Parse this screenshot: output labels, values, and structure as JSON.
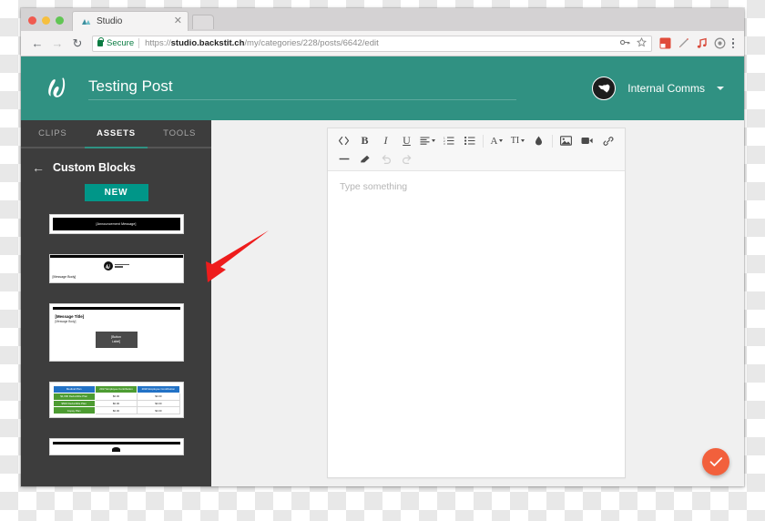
{
  "browser": {
    "tab": {
      "title": "Studio",
      "favicon_icon": "studio-favicon",
      "close_icon": "close-icon"
    },
    "new_tab_icon": "new-tab-icon",
    "nav": {
      "back_icon": "back-arrow-icon",
      "forward_icon": "forward-arrow-icon",
      "reload_icon": "reload-icon"
    },
    "omnibox": {
      "secure_label": "Secure",
      "url_scheme": "https://",
      "url_host": "studio.backstit.ch",
      "url_path": "/my/categories/228/posts/6642/edit",
      "full_url": "https://studio.backstit.ch/my/categories/228/posts/6642/edit",
      "key_icon": "key-icon",
      "star_icon": "star-icon"
    },
    "extensions": [
      "extension-red-icon",
      "extension-pencil-icon",
      "extension-music-icon",
      "extension-grey-icon"
    ],
    "menu_icon": "kebab-menu-icon",
    "traffic_lights": [
      "close-window-button",
      "minimize-window-button",
      "maximize-window-button"
    ]
  },
  "app": {
    "header": {
      "logo_icon": "backstitch-logo",
      "post_title": "Testing Post",
      "account": {
        "avatar_icon": "globe-avatar-icon",
        "name": "Internal Comms",
        "caret_icon": "chevron-down-icon"
      },
      "accent_color": "#309182"
    },
    "sidebar": {
      "tabs": [
        {
          "label": "CLIPS",
          "active": false
        },
        {
          "label": "ASSETS",
          "active": true
        },
        {
          "label": "TOOLS",
          "active": false
        }
      ],
      "back_icon": "back-arrow-icon",
      "section_title": "Custom Blocks",
      "new_button": "NEW",
      "new_button_color": "#009688",
      "blocks": [
        {
          "name": "announcement-block",
          "announcement_text": "[Announcement Message]"
        },
        {
          "name": "logo-message-block",
          "logo_text": "backstitch",
          "logo_sub": "STUDIO",
          "body_text": "[Message Body]"
        },
        {
          "name": "title-body-button-block",
          "title_text": "[Message Title]",
          "body_text": "[Message Body]",
          "button_line1": "[Button",
          "button_line2": "Label]"
        },
        {
          "name": "benefits-table-block",
          "table": {
            "headers": [
              "Medical Plan",
              "2017 Employee Contribution",
              "2018 Employee Contribution"
            ],
            "rows": [
              {
                "label": "$1,000 Deductible Plan",
                "values": [
                  "$0.00",
                  "$0.00"
                ]
              },
              {
                "label": "$500 Deductible Plan",
                "values": [
                  "$0.00",
                  "$0.00"
                ]
              },
              {
                "label": "Copay Plan",
                "values": [
                  "$0.00",
                  "$0.00"
                ]
              }
            ],
            "header_color": "#2272c6",
            "label_color": "#4d9c32"
          }
        },
        {
          "name": "partial-block",
          "label": ""
        }
      ]
    },
    "editor": {
      "toolbar_row1": [
        {
          "name": "code-view-button",
          "glyph": "< >"
        },
        {
          "name": "bold-button",
          "glyph": "B"
        },
        {
          "name": "italic-button",
          "glyph": "I"
        },
        {
          "name": "underline-button",
          "glyph": "U"
        },
        {
          "name": "align-button",
          "glyph": "align"
        },
        {
          "name": "ordered-list-button",
          "glyph": "ol"
        },
        {
          "name": "unordered-list-button",
          "glyph": "ul"
        },
        {
          "name": "text-color-button",
          "glyph": "A"
        },
        {
          "name": "font-size-button",
          "glyph": "TI"
        },
        {
          "name": "highlight-color-button",
          "glyph": "droplet"
        },
        {
          "name": "insert-image-button",
          "glyph": "image"
        },
        {
          "name": "insert-video-button",
          "glyph": "video"
        },
        {
          "name": "insert-link-button",
          "glyph": "link"
        }
      ],
      "toolbar_row2": [
        {
          "name": "horizontal-rule-button",
          "glyph": "minus"
        },
        {
          "name": "clear-formatting-button",
          "glyph": "eraser"
        },
        {
          "name": "undo-button",
          "glyph": "undo",
          "disabled": true
        },
        {
          "name": "redo-button",
          "glyph": "redo",
          "disabled": true
        }
      ],
      "placeholder": "Type something"
    },
    "fab": {
      "name": "save-confirm-button",
      "icon": "check-icon",
      "color": "#f2603c"
    }
  },
  "annotation": {
    "type": "red-arrow",
    "color": "#ee1c1c",
    "points_to": "logo-message-block"
  }
}
